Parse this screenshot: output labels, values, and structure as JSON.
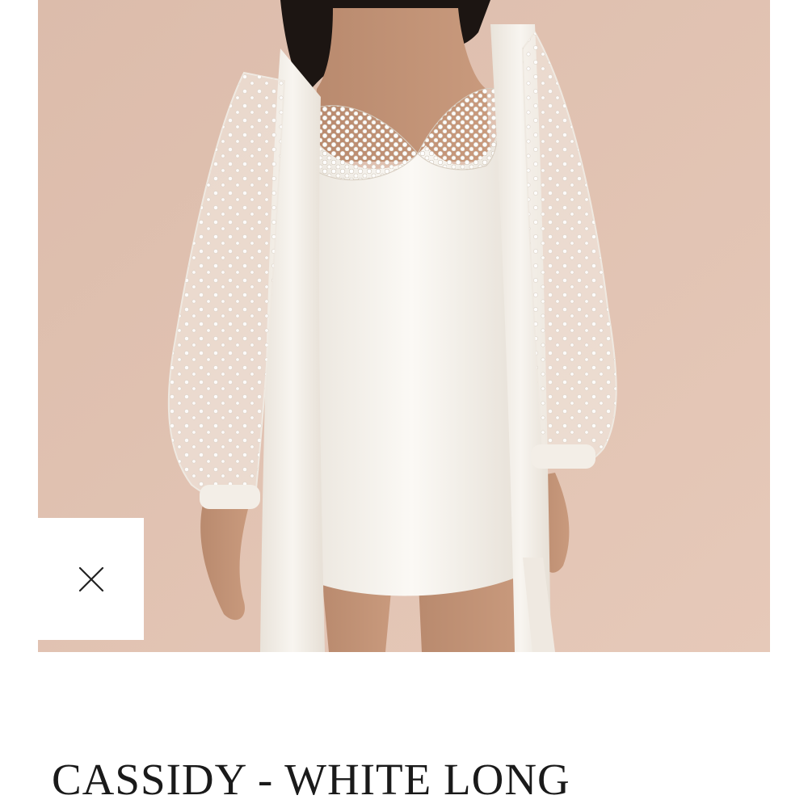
{
  "product": {
    "title": "CASSIDY - WHITE LONG",
    "image_alt": "Model wearing white satin mini slip dress with pearl-embellished cups and a white robe with sheer pearl-studded tulle sleeves"
  },
  "close_button": {
    "icon": "close-icon",
    "aria_label": "Close"
  },
  "colors": {
    "backdrop": "#e1c2b1",
    "garment": "#f6f3ee",
    "title_text": "#1a1a1a"
  }
}
